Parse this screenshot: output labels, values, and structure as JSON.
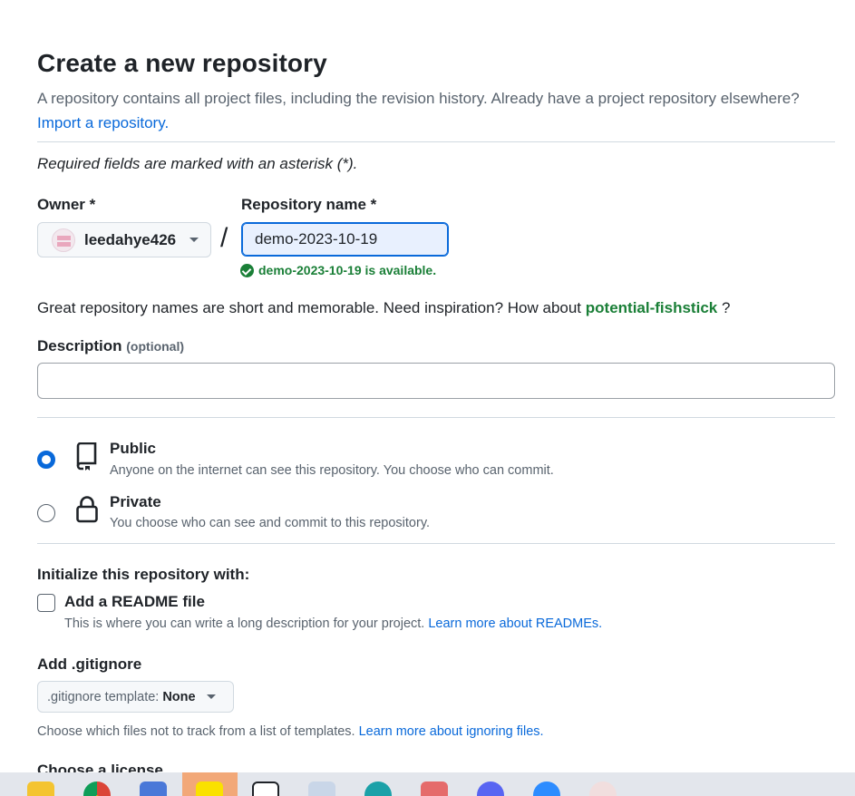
{
  "page": {
    "title": "Create a new repository",
    "intro": "A repository contains all project files, including the revision history. Already have a project repository elsewhere?",
    "import_link": "Import a repository.",
    "required_note": "Required fields are marked with an asterisk (*)."
  },
  "owner": {
    "label": "Owner *",
    "value": "leedahye426"
  },
  "separator": "/",
  "repo": {
    "label": "Repository name *",
    "value": "demo-2023-10-19",
    "availability": "demo-2023-10-19 is available."
  },
  "inspiration": {
    "text": "Great repository names are short and memorable. Need inspiration? How about",
    "suggestion": "potential-fishstick",
    "end": "?"
  },
  "description": {
    "label": "Description",
    "optional": "(optional)",
    "value": ""
  },
  "visibility": {
    "public": {
      "title": "Public",
      "desc": "Anyone on the internet can see this repository. You choose who can commit.",
      "icon": "repo-icon",
      "selected": true
    },
    "private": {
      "title": "Private",
      "desc": "You choose who can see and commit to this repository.",
      "icon": "lock-icon",
      "selected": false
    }
  },
  "initialize": {
    "label": "Initialize this repository with:",
    "readme_title": "Add a README file",
    "readme_desc": "This is where you can write a long description for your project.",
    "readme_link": "Learn more about READMEs.",
    "readme_checked": false
  },
  "gitignore": {
    "label": "Add .gitignore",
    "button_prefix": ".gitignore template:",
    "button_value": "None",
    "desc": "Choose which files not to track from a list of templates.",
    "link": "Learn more about ignoring files."
  },
  "license": {
    "label": "Choose a license"
  },
  "colors": {
    "accent": "#0969da",
    "success": "#1a7f37",
    "muted": "#59636e"
  },
  "taskbar": {
    "icons": [
      "file-explorer-icon",
      "chrome-icon",
      "copilot-icon",
      "kakaotalk-icon",
      "notion-icon",
      "file-icon",
      "edge-icon",
      "app-icon",
      "discord-icon",
      "zoom-icon",
      "app-icon"
    ]
  }
}
